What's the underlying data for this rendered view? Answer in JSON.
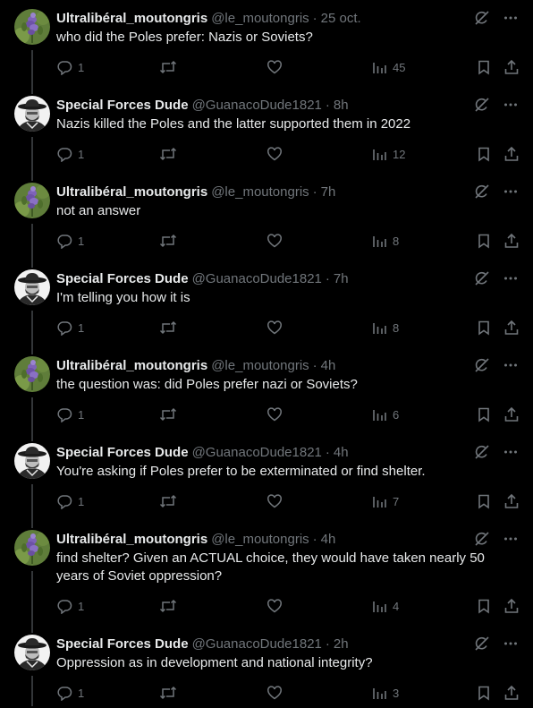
{
  "tweets": [
    {
      "author": "Ultralibéral_moutongris",
      "handle": "@le_moutongris",
      "sep": "·",
      "time": "25 oct.",
      "text": "who did the Poles prefer: Nazis or Soviets?",
      "replies": "1",
      "views": "45",
      "avatar": "flower"
    },
    {
      "author": "Special Forces Dude",
      "handle": "@GuanacoDude1821",
      "sep": "·",
      "time": "8h",
      "text": "Nazis killed the Poles and the latter supported them in 2022",
      "replies": "1",
      "views": "12",
      "avatar": "soldier"
    },
    {
      "author": "Ultralibéral_moutongris",
      "handle": "@le_moutongris",
      "sep": "·",
      "time": "7h",
      "text": "not an answer",
      "replies": "1",
      "views": "8",
      "avatar": "flower"
    },
    {
      "author": "Special Forces Dude",
      "handle": "@GuanacoDude1821",
      "sep": "·",
      "time": "7h",
      "text": "I'm telling you how it is",
      "replies": "1",
      "views": "8",
      "avatar": "soldier"
    },
    {
      "author": "Ultralibéral_moutongris",
      "handle": "@le_moutongris",
      "sep": "·",
      "time": "4h",
      "text": "the question was: did Poles prefer nazi or Soviets?",
      "replies": "1",
      "views": "6",
      "avatar": "flower"
    },
    {
      "author": "Special Forces Dude",
      "handle": "@GuanacoDude1821",
      "sep": "·",
      "time": "4h",
      "text": "You're asking if Poles prefer to be exterminated or find shelter.",
      "replies": "1",
      "views": "7",
      "avatar": "soldier"
    },
    {
      "author": "Ultralibéral_moutongris",
      "handle": "@le_moutongris",
      "sep": "·",
      "time": "4h",
      "text": "find shelter? Given an ACTUAL choice, they would have taken nearly 50 years of Soviet oppression?",
      "replies": "1",
      "views": "4",
      "avatar": "flower"
    },
    {
      "author": "Special Forces Dude",
      "handle": "@GuanacoDude1821",
      "sep": "·",
      "time": "2h",
      "text": "Oppression as in development and national integrity?",
      "replies": "1",
      "views": "3",
      "avatar": "soldier"
    }
  ],
  "icons": [
    "grok-icon",
    "more-icon",
    "reply-icon",
    "retweet-icon",
    "like-icon",
    "views-icon",
    "bookmark-icon",
    "share-icon"
  ],
  "colors": {
    "background": "#000000",
    "text": "#e7e9ea",
    "muted": "#71767b",
    "thread_line": "#333639"
  }
}
